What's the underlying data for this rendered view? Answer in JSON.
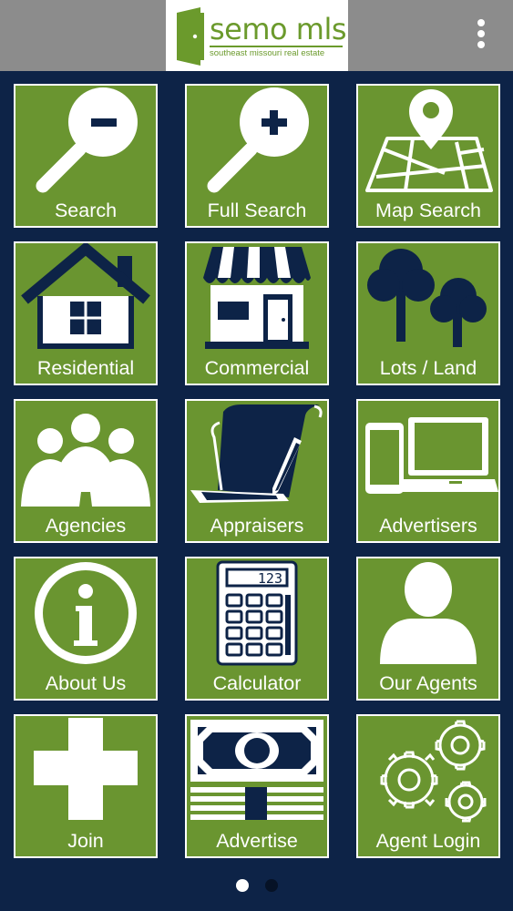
{
  "header": {
    "logo_text": "semo mls",
    "logo_subtitle": "southeast missouri real estate",
    "menu_icon": "more-vertical-icon"
  },
  "colors": {
    "tile_green": "#6a9530",
    "background_navy": "#0d2347",
    "topbar_gray": "#8c8c8c",
    "logo_green": "#6b9a2c"
  },
  "tiles": [
    {
      "label": "Search",
      "icon": "magnifier-minus-icon"
    },
    {
      "label": "Full Search",
      "icon": "magnifier-plus-icon"
    },
    {
      "label": "Map Search",
      "icon": "map-pin-icon"
    },
    {
      "label": "Residential",
      "icon": "house-icon"
    },
    {
      "label": "Commercial",
      "icon": "storefront-icon"
    },
    {
      "label": "Lots / Land",
      "icon": "trees-icon"
    },
    {
      "label": "Agencies",
      "icon": "people-group-icon"
    },
    {
      "label": "Appraisers",
      "icon": "document-pen-icon"
    },
    {
      "label": "Advertisers",
      "icon": "devices-icon"
    },
    {
      "label": "About Us",
      "icon": "info-icon"
    },
    {
      "label": "Calculator",
      "icon": "calculator-icon"
    },
    {
      "label": "Our Agents",
      "icon": "person-icon"
    },
    {
      "label": "Join",
      "icon": "plus-icon"
    },
    {
      "label": "Advertise",
      "icon": "money-stack-icon"
    },
    {
      "label": "Agent Login",
      "icon": "gears-icon"
    }
  ],
  "calculator_display": "123",
  "pagination": {
    "current": 1,
    "total": 2
  }
}
